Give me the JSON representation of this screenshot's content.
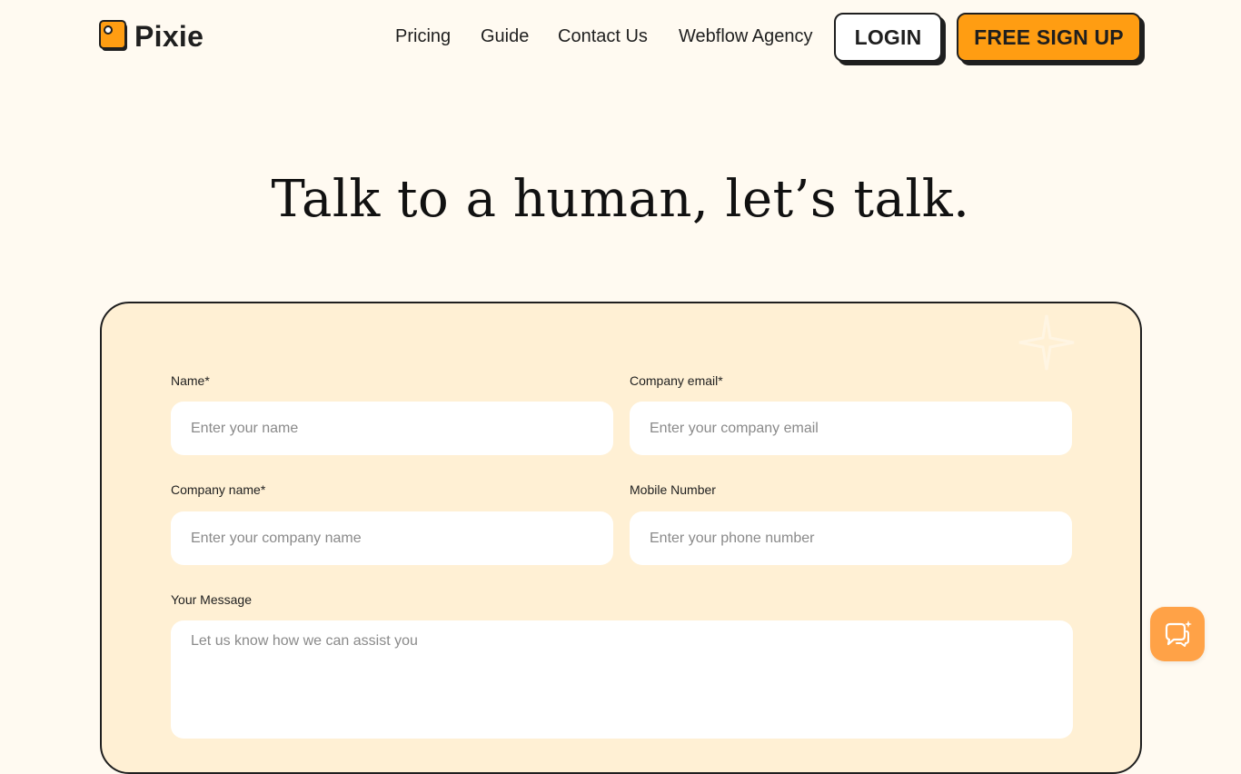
{
  "brand": {
    "name": "Pixie",
    "accent": "#ff9d12",
    "background": "#fffaf1",
    "card_background": "#fff0d4"
  },
  "nav": {
    "items": [
      {
        "label": "Pricing"
      },
      {
        "label": "Guide"
      },
      {
        "label": "Contact Us"
      },
      {
        "label": "Webflow Agency"
      }
    ],
    "login_label": "LOGIN",
    "signup_label": "FREE SIGN UP"
  },
  "hero": {
    "title": "Talk to a human, let’s talk."
  },
  "form": {
    "name": {
      "label": "Name*",
      "placeholder": "Enter your name",
      "value": ""
    },
    "company_email": {
      "label": "Company email*",
      "placeholder": "Enter your company email",
      "value": ""
    },
    "company_name": {
      "label": "Company name*",
      "placeholder": "Enter your company name",
      "value": ""
    },
    "mobile_number": {
      "label": "Mobile Number",
      "placeholder": "Enter your phone number",
      "value": ""
    },
    "message": {
      "label": "Your Message",
      "placeholder": "Let us know how we can assist you",
      "value": ""
    }
  },
  "chat_widget": {
    "icon": "chat-sparkle-icon",
    "color": "#ffa247"
  }
}
